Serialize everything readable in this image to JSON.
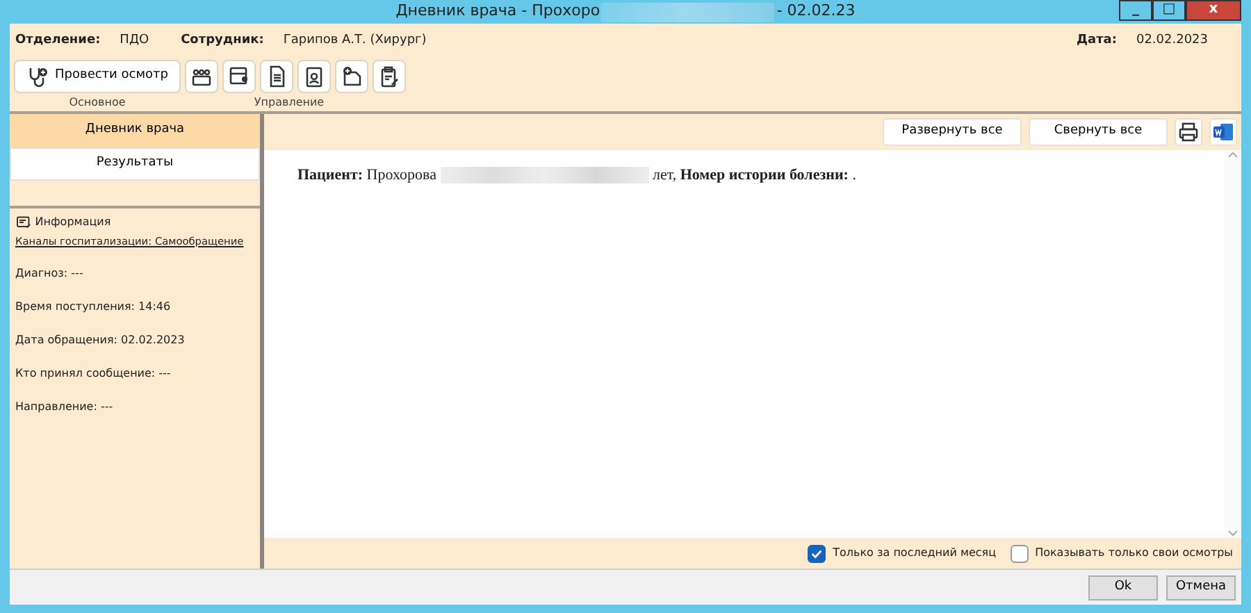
{
  "window": {
    "title_left": "Дневник врача - Прохоро",
    "title_right": "- 02.02.23",
    "controls": [
      "_",
      "□",
      "x"
    ]
  },
  "header": {
    "fields": [
      {
        "label": "Отделение:",
        "value": "ПДО"
      },
      {
        "label": "Сотрудник:",
        "value": "Гарипов А.Т. (Хирург)"
      }
    ],
    "date": {
      "label": "Дата:",
      "value": "02.02.2023"
    }
  },
  "toolbar": {
    "main_button": "Провести осмотр",
    "groups": [
      "Основное",
      "Управление"
    ]
  },
  "sidebar": {
    "tabs": [
      {
        "label": "Дневник врача",
        "selected": true
      },
      {
        "label": "Результаты",
        "selected": false
      }
    ],
    "info_title": "Информация",
    "link": "Каналы госпитализации: Самообращение",
    "items": [
      "Диагноз: ---",
      "Время поступления: 14:46",
      "Дата обращения: 02.02.2023",
      "Кто принял сообщение: ---",
      "Направление: ---"
    ]
  },
  "content": {
    "buttons": [
      "Развернуть все",
      "Свернуть все"
    ],
    "patient_line": {
      "label": "Пациент:",
      "name": "Прохорова",
      "age_suffix": "лет,",
      "history_label": "Номер истории болезни:",
      "history_value": "."
    }
  },
  "filters": [
    {
      "label": "Только за последний месяц",
      "checked": true
    },
    {
      "label": "Показывать только свои осмотры",
      "checked": false
    }
  ],
  "footer_buttons": [
    "Ok",
    "Отмена"
  ]
}
